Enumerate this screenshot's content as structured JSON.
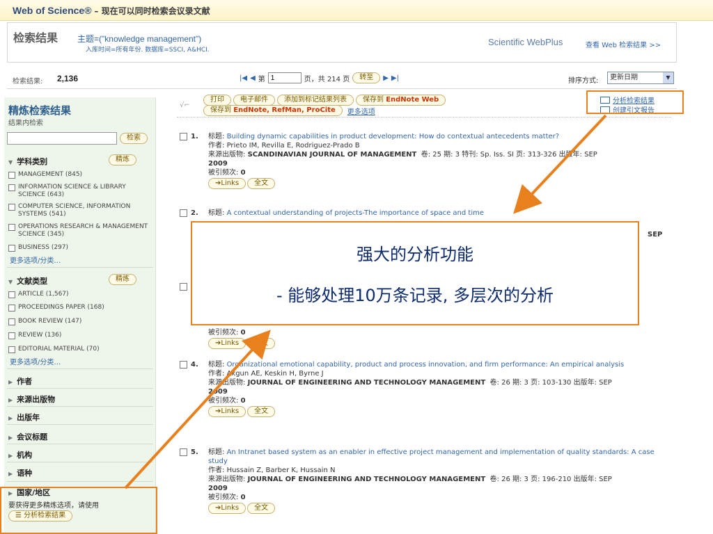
{
  "topbar": {
    "brand": "Web of Science®",
    "subtitle": "– 现在可以同时检索会议录文献"
  },
  "header": {
    "title": "检索结果",
    "query": "主题=(\"knowledge management\")",
    "scope": "入库时间=所有年份. 数据库=SSCI, A&HCI.",
    "webplus_brand": "Scientific WebPlus",
    "webplus_link": "查看 Web 检索结果 >>"
  },
  "pager": {
    "count_label": "检索结果:",
    "count": "2,136",
    "page_prefix": "第",
    "page_value": "1",
    "page_suffix": "页，共 214 页",
    "go_label": "转至",
    "sort_label": "排序方式:",
    "sort_value": "更新日期"
  },
  "sidebar": {
    "title": "精炼检索结果",
    "within_label": "结果内检索",
    "search_button": "检索",
    "refine_button": "精炼",
    "sections": {
      "subject": "学科类别",
      "doctype": "文献类型",
      "author": "作者",
      "source": "来源出版物",
      "year": "出版年",
      "conference": "会议标题",
      "org": "机构",
      "language": "语种",
      "country": "国家/地区"
    },
    "subject_items": [
      "MANAGEMENT (845)",
      "INFORMATION SCIENCE & LIBRARY SCIENCE (643)",
      "COMPUTER SCIENCE, INFORMATION SYSTEMS (541)",
      "OPERATIONS RESEARCH & MANAGEMENT SCIENCE (345)",
      "BUSINESS (297)"
    ],
    "doctype_items": [
      "ARTICLE (1,567)",
      "PROCEEDINGS PAPER (168)",
      "BOOK REVIEW (147)",
      "REVIEW (136)",
      "EDITORIAL MATERIAL (70)"
    ],
    "more_label": "更多选项/分类…",
    "note": "要获得更多精炼选项，请使用",
    "analyze_button": "分析检索结果"
  },
  "toolbar": {
    "print": "打印",
    "email": "电子邮件",
    "add_marked": "添加到标记结果列表",
    "save_to": "保存到",
    "endnote_web": "EndNote Web",
    "save_to2": "保存到",
    "endnote_refman": "EndNote, RefMan, ProCite",
    "more_options": "更多选项",
    "analyze": "分析检索结果",
    "citation_report": "创建引文报告"
  },
  "records": [
    {
      "num": "1.",
      "title_label": "标题:",
      "title": "Building dynamic capabilities in product development: How do contextual antecedents matter?",
      "authors_label": "作者:",
      "authors": "Prieto IM, Revilla E, Rodriguez-Prado B",
      "source_label": "来源出版物:",
      "source": "SCANDINAVIAN JOURNAL OF MANAGEMENT",
      "details": "卷: 25  期: 3  特刊: Sp. Iss. SI  页: 313-326  出版年: SEP",
      "year": "2009",
      "cited_label": "被引频次:",
      "cited": "0"
    },
    {
      "num": "2.",
      "title_label": "标题:",
      "title": "A contextual understanding of projects-The importance of space and time"
    },
    {
      "num": "3.",
      "cited_label": "被引频次:",
      "cited": "0"
    },
    {
      "num": "4.",
      "title_label": "标题:",
      "title": "Organizational emotional capability, product and process innovation, and firm performance: An empirical analysis",
      "authors_label": "作者:",
      "authors": "Akgun AE, Keskin H, Byrne J",
      "source_label": "来源出版物:",
      "source": "JOURNAL OF ENGINEERING AND TECHNOLOGY MANAGEMENT",
      "details": "卷: 26  期: 3  页: 103-130  出版年: SEP",
      "year": "2009",
      "cited_label": "被引频次:",
      "cited": "0"
    },
    {
      "num": "5.",
      "title_label": "标题:",
      "title": "An Intranet based system as an enabler in effective project management and implementation of quality standards: A case study",
      "authors_label": "作者:",
      "authors": "Hussain Z, Barber K, Hussain N",
      "source_label": "来源出版物:",
      "source": "JOURNAL OF ENGINEERING AND TECHNOLOGY MANAGEMENT",
      "details": "卷: 26  期: 3  页: 196-210  出版年: SEP",
      "year": "2009",
      "cited_label": "被引频次:",
      "cited": "0"
    }
  ],
  "record_buttons": {
    "links": "Links",
    "fulltext": "全文"
  },
  "partial_sep": "SEP",
  "callout": {
    "line1": "强大的分析功能",
    "line2": "- 能够处理10万条记录, 多层次的分析"
  },
  "colors": {
    "highlight": "#e8801e",
    "link": "#3366aa",
    "callout_text": "#0e2b6e"
  }
}
